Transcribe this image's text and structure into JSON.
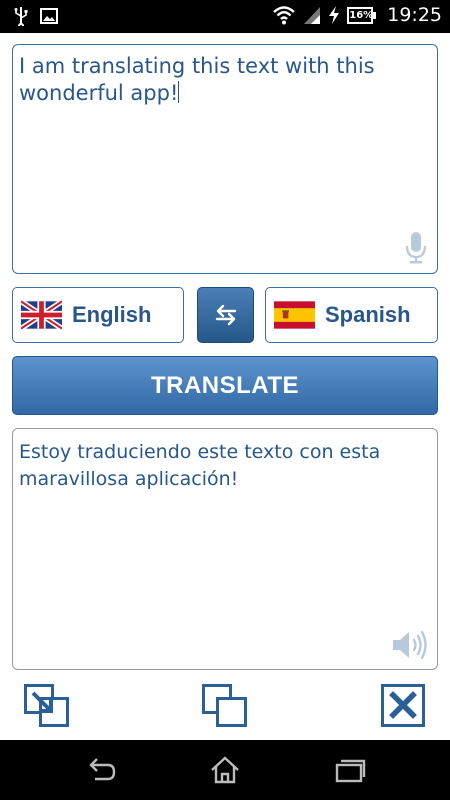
{
  "status_bar": {
    "time": "19:25",
    "battery": "16%",
    "icons": [
      "usb-icon",
      "image-icon",
      "wifi-icon",
      "signal-icon",
      "battery-icon"
    ]
  },
  "source_panel": {
    "text": "I am translating this text with this wonderful app!",
    "mic_icon": "microphone-icon"
  },
  "languages": {
    "source": {
      "label": "English",
      "flag_icon": "uk-flag-icon"
    },
    "target": {
      "label": "Spanish",
      "flag_icon": "spain-flag-icon"
    },
    "swap_icon": "swap-arrows-icon"
  },
  "translate_button": {
    "label": "TRANSLATE"
  },
  "target_panel": {
    "text": "Estoy traduciendo este texto con esta maravillosa aplicación!",
    "speaker_icon": "speaker-icon"
  },
  "toolbar": {
    "icons": [
      "copy-to-source-icon",
      "copy-icon",
      "clear-icon"
    ]
  },
  "colors": {
    "accent": "#27578c",
    "button_top": "#5d93cc",
    "button_bottom": "#3169a6",
    "border": "#3f6f9c"
  },
  "nav_bar": {
    "icons": [
      "back-icon",
      "home-icon",
      "recent-apps-icon"
    ]
  }
}
